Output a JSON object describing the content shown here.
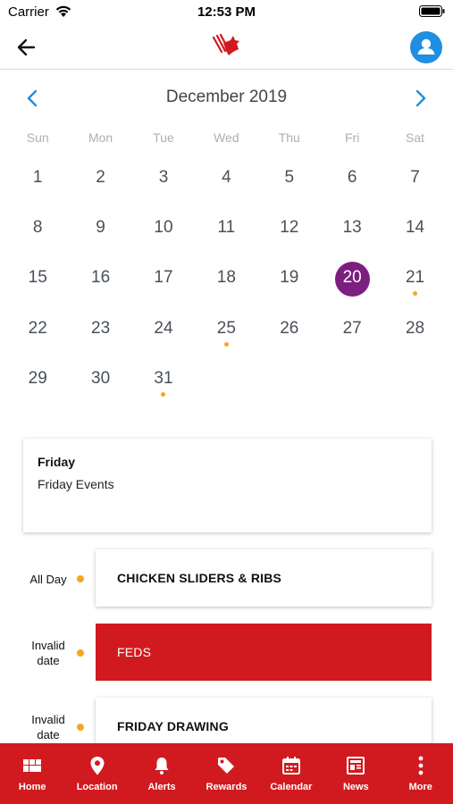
{
  "status_bar": {
    "carrier": "Carrier",
    "time": "12:53 PM"
  },
  "header": {
    "back_icon": "arrow-left-icon",
    "logo_icon": "bull-logo-icon",
    "profile_icon": "user-icon"
  },
  "calendar": {
    "month_title": "December 2019",
    "weekdays": [
      "Sun",
      "Mon",
      "Tue",
      "Wed",
      "Thu",
      "Fri",
      "Sat"
    ],
    "weeks": [
      [
        "1",
        "2",
        "3",
        "4",
        "5",
        "6",
        "7"
      ],
      [
        "8",
        "9",
        "10",
        "11",
        "12",
        "13",
        "14"
      ],
      [
        "15",
        "16",
        "17",
        "18",
        "19",
        "20",
        "21"
      ],
      [
        "22",
        "23",
        "24",
        "25",
        "26",
        "27",
        "28"
      ],
      [
        "29",
        "30",
        "31",
        "",
        "",
        "",
        ""
      ]
    ],
    "selected_day": "20",
    "event_days": [
      "21",
      "25",
      "31"
    ],
    "colors": {
      "selected": "#7b1f80",
      "event_dot": "#f5a623",
      "nav_arrow": "#1e8fe1"
    }
  },
  "day_card": {
    "title": "Friday",
    "subtitle": "Friday Events"
  },
  "events": [
    {
      "time": "All Day",
      "title": "CHICKEN SLIDERS & RIBS",
      "highlighted": false
    },
    {
      "time": "Invalid date",
      "title": "FEDS",
      "highlighted": true
    },
    {
      "time": "Invalid date",
      "title": "FRIDAY DRAWING",
      "highlighted": false
    }
  ],
  "tab_bar": {
    "color": "#d11a1f",
    "items": [
      {
        "label": "Home",
        "icon": "grid-icon"
      },
      {
        "label": "Location",
        "icon": "map-pin-icon"
      },
      {
        "label": "Alerts",
        "icon": "bell-icon"
      },
      {
        "label": "Rewards",
        "icon": "tag-icon"
      },
      {
        "label": "Calendar",
        "icon": "calendar-icon"
      },
      {
        "label": "News",
        "icon": "newspaper-icon"
      },
      {
        "label": "More",
        "icon": "more-vertical-icon"
      }
    ]
  }
}
